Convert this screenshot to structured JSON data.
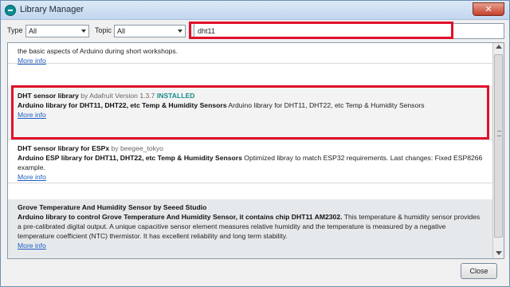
{
  "window": {
    "title": "Library Manager"
  },
  "filters": {
    "type_label": "Type",
    "type_value": "All",
    "topic_label": "Topic",
    "topic_value": "All",
    "search_value": "dht11"
  },
  "libraries": [
    {
      "id": "prev",
      "desc_plain": "the basic aspects of Arduino during short workshops.",
      "more": "More info"
    },
    {
      "id": "dht",
      "name": "DHT sensor library",
      "by": "by Adafruit Version 1.3.7",
      "status": "INSTALLED",
      "desc_bold": "Arduino library for DHT11, DHT22, etc Temp & Humidity Sensors",
      "desc_plain": "Arduino library for DHT11, DHT22, etc Temp & Humidity Sensors",
      "more": "More info"
    },
    {
      "id": "espx",
      "name": "DHT sensor library for ESPx",
      "by": "by beegee_tokyo",
      "desc_bold": "Arduino ESP library for DHT11, DHT22, etc Temp & Humidity Sensors",
      "desc_plain": "Optimized libray to match ESP32 requirements. Last changes: Fixed ESP8266 example.",
      "more": "More info"
    },
    {
      "id": "grove",
      "name": "Grove Temperature And Humidity Sensor",
      "by": "by Seeed Studio",
      "desc_bold": "Arduino library to control Grove Temperature And Humidity Sensor, it contains chip DHT11 AM2302.",
      "desc_plain": "This temperature & humidity sensor provides a pre-calibrated digital output. A unique capacitive sensor element measures relative humidity and the temperature is measured by a negative temperature coefficient (NTC) thermistor. It has excellent reliability and long term stability.",
      "more": "More info"
    }
  ],
  "footer": {
    "close_label": "Close"
  },
  "colors": {
    "highlight": "#e0102a",
    "installed": "#1b8a8a",
    "link": "#1f5fbf"
  }
}
